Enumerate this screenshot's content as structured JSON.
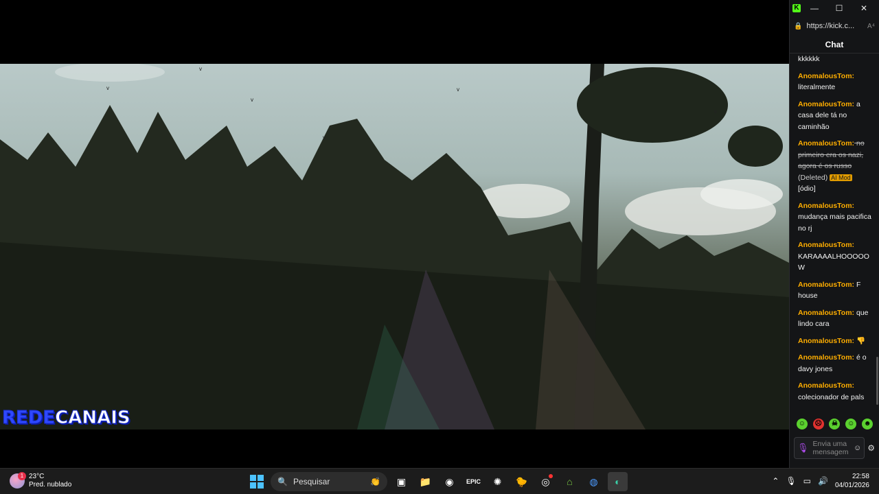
{
  "browser": {
    "url": "https://kick.c...",
    "reader_label": "A⁴",
    "buttons": {
      "minimize": "—",
      "maximize": "☐",
      "close": "✕"
    }
  },
  "watermark": {
    "part1": "REDE",
    "part2": "CANAIS"
  },
  "chat": {
    "title": "Chat",
    "messages": [
      {
        "user": "",
        "text": "kkkkkk"
      },
      {
        "user": "AnomalousTom:",
        "text": " literalmente"
      },
      {
        "user": "AnomalousTom:",
        "text": " a casa dele tá no caminhão"
      },
      {
        "user": "AnomalousTom:",
        "text": " no primeiro era os nazi, agora é os russo",
        "deleted_label": " (Deleted) ",
        "mod_badge": "AI Mod",
        "mod_reason": " [ódio]"
      },
      {
        "user": "AnomalousTom:",
        "text": " mudança mais pacifica no rj"
      },
      {
        "user": "AnomalousTom:",
        "text": " KARAAAALHOOOOOW"
      },
      {
        "user": "AnomalousTom:",
        "text": " F house"
      },
      {
        "user": "AnomalousTom:",
        "text": " que lindo cara"
      },
      {
        "user": "AnomalousTom:",
        "text": " 👎"
      },
      {
        "user": "AnomalousTom:",
        "text": " é o davy jones"
      },
      {
        "user": "AnomalousTom:",
        "text": " colecionador de pals"
      }
    ],
    "input_placeholder": "Envia uma mensagem",
    "emotes": [
      "☺",
      "☹",
      "☠",
      "☺",
      "☻"
    ]
  },
  "taskbar": {
    "weather_temp": "23°C",
    "weather_desc": "Pred. nublado",
    "weather_badge": "1",
    "search_label": "Pesquisar",
    "time": "22:58",
    "date": "04/01/2026"
  }
}
